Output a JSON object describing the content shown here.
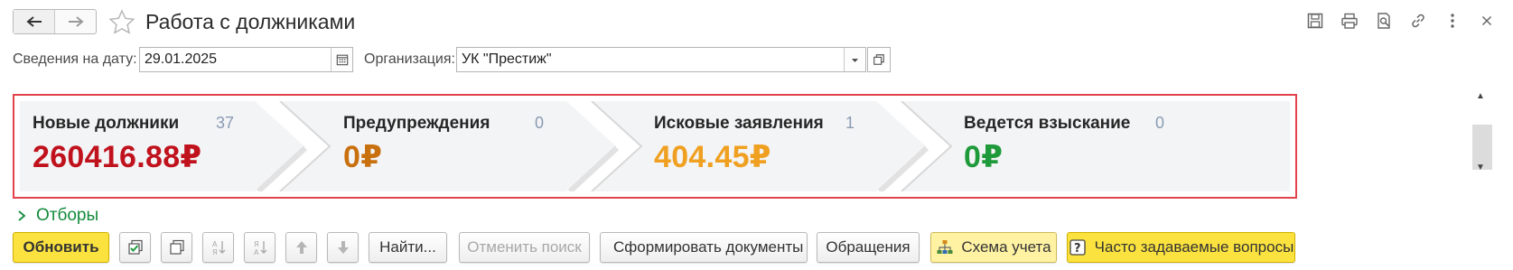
{
  "window": {
    "title": "Работа с должниками"
  },
  "filters": {
    "date_label": "Сведения на дату:",
    "date_value": "29.01.2025",
    "org_label": "Организация:",
    "org_value": "УК \"Престиж\""
  },
  "dashboard": {
    "stages": [
      {
        "title": "Новые должники",
        "count": "37",
        "amount": "260416.88₽",
        "color": "#c0121d"
      },
      {
        "title": "Предупреждения",
        "count": "0",
        "amount": "0₽",
        "color": "#c9700e"
      },
      {
        "title": "Исковые заявления",
        "count": "1",
        "amount": "404.45₽",
        "color": "#f0a020"
      },
      {
        "title": "Ведется взыскание",
        "count": "0",
        "amount": "0₽",
        "color": "#1f9a3a"
      }
    ]
  },
  "filters_link": "Отборы",
  "toolbar": {
    "refresh": "Обновить",
    "find": "Найти...",
    "cancel_search": "Отменить поиск",
    "generate_docs": "Сформировать документы",
    "requests": "Обращения",
    "accounting_scheme": "Схема учета",
    "faq": "Часто задаваемые вопросы"
  },
  "colors": {
    "accent_yellow": "#fbe23e",
    "highlight_border": "#e2434b",
    "link_green": "#138a3c"
  }
}
